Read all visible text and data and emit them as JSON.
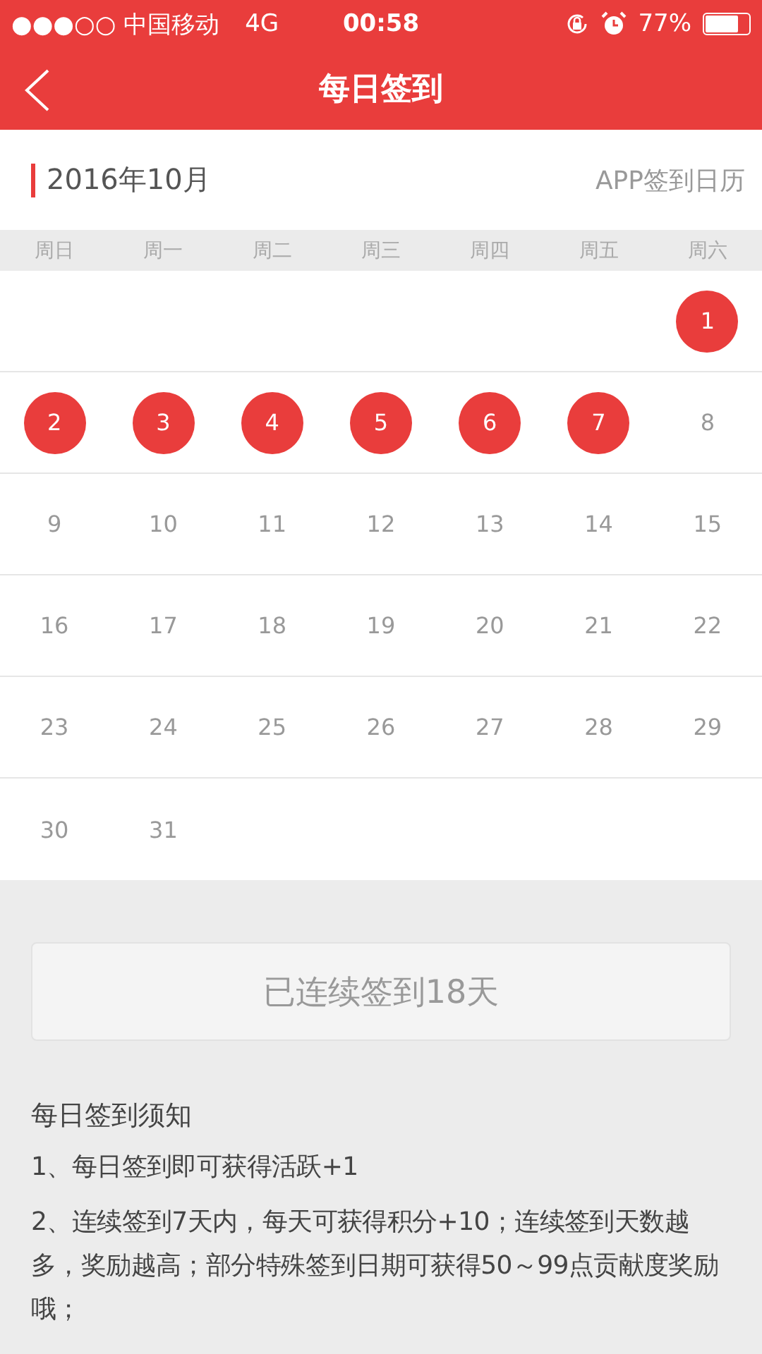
{
  "status_bar": {
    "carrier": "●●●○○ 中国移动",
    "network": "4G",
    "time": "00:58",
    "battery": "77%"
  },
  "nav": {
    "title": "每日签到"
  },
  "calendar": {
    "month": "2016年10月",
    "link": "APP签到日历",
    "weekdays": [
      "周日",
      "周一",
      "周二",
      "周三",
      "周四",
      "周五",
      "周六"
    ],
    "weeks": [
      {
        "kind": "end_aligned",
        "days": [
          {
            "day": "1",
            "signed": true
          }
        ]
      },
      {
        "kind": "start_aligned",
        "days": [
          {
            "day": "2",
            "signed": true
          },
          {
            "day": "3",
            "signed": true
          },
          {
            "day": "4",
            "signed": true
          },
          {
            "day": "5",
            "signed": true
          },
          {
            "day": "6",
            "signed": true
          },
          {
            "day": "7",
            "signed": true
          },
          {
            "day": "8",
            "signed": false
          }
        ]
      },
      {
        "kind": "start_aligned",
        "days": [
          {
            "day": "9",
            "signed": false
          },
          {
            "day": "10",
            "signed": false
          },
          {
            "day": "11",
            "signed": false
          },
          {
            "day": "12",
            "signed": false
          },
          {
            "day": "13",
            "signed": false
          },
          {
            "day": "14",
            "signed": false
          },
          {
            "day": "15",
            "signed": false
          }
        ]
      },
      {
        "kind": "start_aligned",
        "days": [
          {
            "day": "16",
            "signed": false
          },
          {
            "day": "17",
            "signed": false
          },
          {
            "day": "18",
            "signed": false
          },
          {
            "day": "19",
            "signed": false
          },
          {
            "day": "20",
            "signed": false
          },
          {
            "day": "21",
            "signed": false
          },
          {
            "day": "22",
            "signed": false
          }
        ]
      },
      {
        "kind": "start_aligned",
        "days": [
          {
            "day": "23",
            "signed": false
          },
          {
            "day": "24",
            "signed": false
          },
          {
            "day": "25",
            "signed": false
          },
          {
            "day": "26",
            "signed": false
          },
          {
            "day": "27",
            "signed": false
          },
          {
            "day": "28",
            "signed": false
          },
          {
            "day": "29",
            "signed": false
          }
        ]
      },
      {
        "kind": "start_aligned",
        "days": [
          {
            "day": "30",
            "signed": false
          },
          {
            "day": "31",
            "signed": false
          }
        ]
      }
    ]
  },
  "streak_button": {
    "label": "已连续签到18天",
    "disabled": true
  },
  "notes": {
    "title": "每日签到须知",
    "items": [
      "1、每日签到即可获得活跃+1",
      "2、连续签到7天内，每天可获得积分+10；连续签到天数越多，奖励越高；部分特殊签到日期可获得50～99点贡献度奖励哦；"
    ]
  }
}
